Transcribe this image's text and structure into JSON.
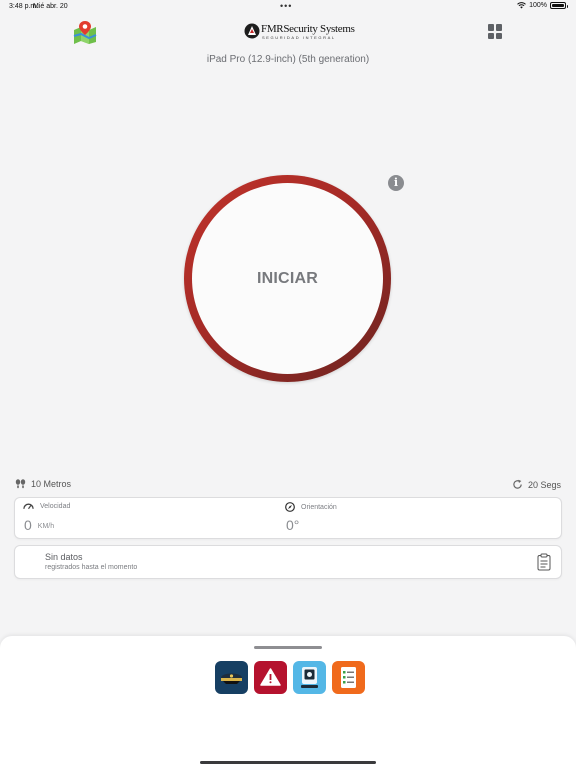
{
  "status_bar": {
    "time": "3:48 p.m.",
    "date": "Mié abr. 20",
    "battery": "100%"
  },
  "header": {
    "logo_title": "FMRSecurity Systems",
    "logo_subtitle": "SEGURIDAD INTEGRAL",
    "device_name": "iPad Pro (12.9-inch) (5th generation)",
    "icons": [
      "map-pin-icon",
      "grid-menu-icon"
    ]
  },
  "main": {
    "start_label": "INICIAR",
    "info_icon": "info-icon"
  },
  "tracking": {
    "distance_label": "10 Metros",
    "interval_label": "20 Segs"
  },
  "metrics": {
    "speed_label": "Velocidad",
    "speed_value": "0",
    "speed_unit": "KM/h",
    "orientation_label": "Orientación",
    "orientation_value": "0°"
  },
  "data_card": {
    "title": "Sin datos",
    "subtitle": "registrados hasta el momento"
  },
  "dock": {
    "apps": [
      "guard-cap-app",
      "alert-app",
      "kiosk-app",
      "report-app"
    ]
  },
  "colors": {
    "ring_start": "#c0332b",
    "ring_end": "#6b2420",
    "guard_app": "#163f63",
    "alert_app": "#b5122e",
    "kiosk_app": "#54b7e6",
    "report_app": "#f06a1c"
  }
}
